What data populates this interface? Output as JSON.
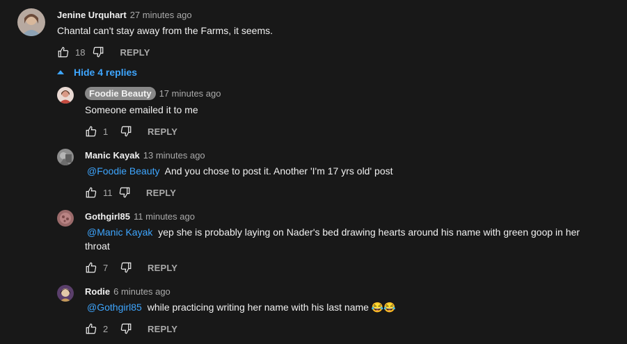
{
  "colors": {
    "background": "#181818",
    "text": "#f1f1f1",
    "muted": "#aaaaaa",
    "link": "#3ea6ff",
    "badge": "#888888"
  },
  "comment": {
    "author": "Jenine Urquhart",
    "time": "27 minutes ago",
    "text": "Chantal can't stay away from the Farms, it seems.",
    "likes": "18",
    "reply_label": "REPLY"
  },
  "replies_toggle": {
    "label": "Hide 4 replies",
    "icon": "caret-up-icon"
  },
  "replies": [
    {
      "author": "Foodie Beauty",
      "time": "17 minutes ago",
      "mention": "",
      "text": "Someone emailed it to me",
      "likes": "1",
      "reply_label": "REPLY"
    },
    {
      "author": "Manic Kayak",
      "time": "13 minutes ago",
      "mention": "@Foodie Beauty",
      "text": "And you chose to post it. Another 'I'm 17 yrs old' post",
      "likes": "11",
      "reply_label": "REPLY"
    },
    {
      "author": "Gothgirl85",
      "time": "11 minutes ago",
      "mention": "@Manic Kayak",
      "text": "yep she is probably laying on Nader's bed drawing hearts around his name with green goop in her throat",
      "likes": "7",
      "reply_label": "REPLY"
    },
    {
      "author": "Rodie",
      "time": "6 minutes ago",
      "mention": "@Gothgirl85",
      "text": "while practicing writing her name with his last name 😂😂",
      "likes": "2",
      "reply_label": "REPLY"
    }
  ]
}
